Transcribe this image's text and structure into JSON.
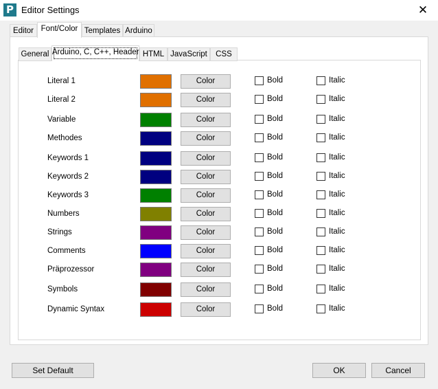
{
  "window": {
    "title": "Editor Settings",
    "icon_letter": "P",
    "close_glyph": "✕"
  },
  "outer_tabs": [
    "Editor",
    "Font/Color",
    "Templates",
    "Arduino"
  ],
  "inner_tabs": [
    "General",
    "Arduino, C, C++, Header",
    "HTML",
    "JavaScript",
    "CSS"
  ],
  "color_button_label": "Color",
  "bold_label": "Bold",
  "italic_label": "Italic",
  "rows": [
    {
      "label": "Literal 1",
      "color": "#e07000"
    },
    {
      "label": "Literal 2",
      "color": "#e07000"
    },
    {
      "label": "Variable",
      "color": "#008000"
    },
    {
      "label": "Methodes",
      "color": "#000080"
    },
    {
      "label": "Keywords 1",
      "color": "#000080"
    },
    {
      "label": "Keywords 2",
      "color": "#000080"
    },
    {
      "label": "Keywords 3",
      "color": "#008000"
    },
    {
      "label": "Numbers",
      "color": "#808000"
    },
    {
      "label": "Strings",
      "color": "#800080"
    },
    {
      "label": "Comments",
      "color": "#0000ff"
    },
    {
      "label": "Präprozessor",
      "color": "#800080"
    },
    {
      "label": "Symbols",
      "color": "#800000"
    },
    {
      "label": "Dynamic Syntax",
      "color": "#cc0000"
    }
  ],
  "buttons": {
    "set_default": "Set Default",
    "ok": "OK",
    "cancel": "Cancel"
  }
}
